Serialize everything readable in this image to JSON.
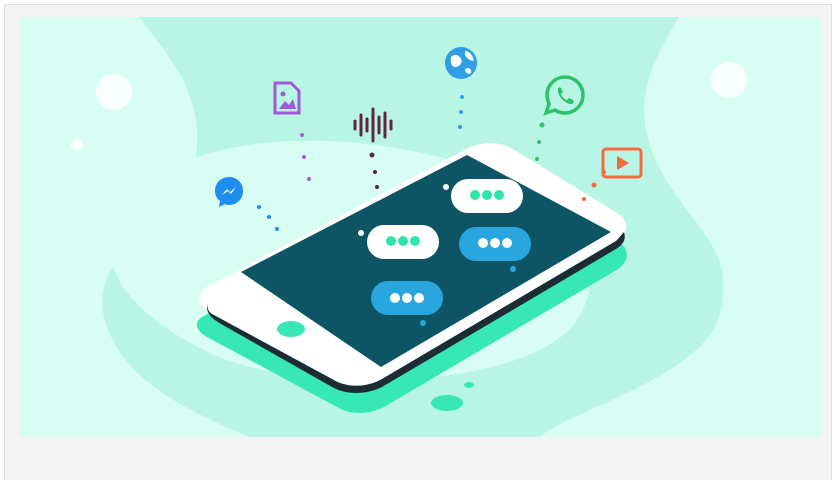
{
  "card": {
    "illustration": {
      "subject": "smartphone-with-chat-bubbles-and-app-icons",
      "icons": [
        "messenger-icon",
        "image-file-icon",
        "audio-wave-icon",
        "globe-icon",
        "whatsapp-icon",
        "video-play-icon"
      ],
      "colors": {
        "background": "#b9f5e4",
        "blob": "#d8fdf3",
        "phone_body": "#ffffff",
        "screen": "#0d5564",
        "bubble_white": "#ffffff",
        "bubble_blue": "#2aa6de",
        "dots_green": "#2ee6a6",
        "phone_shadow": "#37e8b4",
        "messenger": "#1d8ef0",
        "image_file": "#a05ad8",
        "audio": "#5e2740",
        "globe": "#2f9ee6",
        "whatsapp": "#2bc268",
        "video": "#f26a3d"
      }
    },
    "caption": ""
  }
}
